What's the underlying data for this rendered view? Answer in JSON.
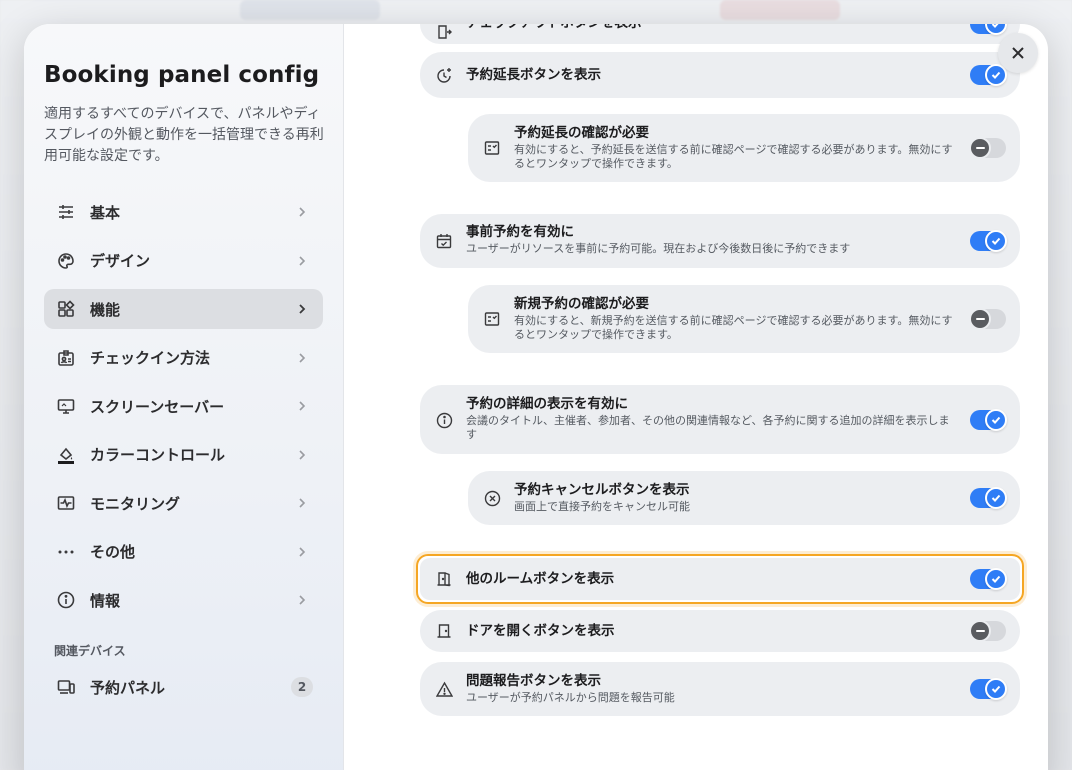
{
  "sidebar": {
    "title": "Booking panel config",
    "description": "適用するすべてのデバイスで、パネルやディスプレイの外観と動作を一括管理できる再利用可能な設定です。",
    "items": [
      {
        "label": "基本",
        "icon": "sliders-icon",
        "active": false
      },
      {
        "label": "デザイン",
        "icon": "palette-icon",
        "active": false
      },
      {
        "label": "機能",
        "icon": "widgets-icon",
        "active": true
      },
      {
        "label": "チェックイン方法",
        "icon": "badge-icon",
        "active": false
      },
      {
        "label": "スクリーンセーバー",
        "icon": "monitor-icon",
        "active": false
      },
      {
        "label": "カラーコントロール",
        "icon": "paint-bucket-icon",
        "active": false
      },
      {
        "label": "モニタリング",
        "icon": "pulse-icon",
        "active": false
      },
      {
        "label": "その他",
        "icon": "more-icon",
        "active": false
      },
      {
        "label": "情報",
        "icon": "info-icon",
        "active": false
      }
    ],
    "related_section": "関連デバイス",
    "related_device": {
      "label": "予約パネル",
      "count": "2",
      "icon": "devices-icon"
    }
  },
  "settings": [
    {
      "title": "チェックアウトボタンを表示",
      "subtitle": "",
      "enabled": true,
      "icon": "checkout-icon"
    },
    {
      "title": "予約延長ボタンを表示",
      "subtitle": "",
      "enabled": true,
      "icon": "clock-plus-icon"
    },
    {
      "title": "予約延長の確認が必要",
      "subtitle": "有効にすると、予約延長を送信する前に確認ページで確認する必要があります。無効にするとワンタップで操作できます。",
      "enabled": false,
      "icon": "checklist-icon"
    },
    {
      "title": "事前予約を有効に",
      "subtitle": "ユーザーがリソースを事前に予約可能。現在および今後数日後に予約できます",
      "enabled": true,
      "icon": "calendar-check-icon"
    },
    {
      "title": "新規予約の確認が必要",
      "subtitle": "有効にすると、新規予約を送信する前に確認ページで確認する必要があります。無効にするとワンタップで操作できます。",
      "enabled": false,
      "icon": "checklist-icon"
    },
    {
      "title": "予約の詳細の表示を有効に",
      "subtitle": "会議のタイトル、主催者、参加者、その他の関連情報など、各予約に関する追加の詳細を表示します",
      "enabled": true,
      "icon": "info-icon"
    },
    {
      "title": "予約キャンセルボタンを表示",
      "subtitle": "画面上で直接予約をキャンセル可能",
      "enabled": true,
      "icon": "cancel-circle-icon"
    },
    {
      "title": "他のルームボタンを表示",
      "subtitle": "",
      "enabled": true,
      "icon": "door-open-icon"
    },
    {
      "title": "ドアを開くボタンを表示",
      "subtitle": "",
      "enabled": false,
      "icon": "door-icon"
    },
    {
      "title": "問題報告ボタンを表示",
      "subtitle": "ユーザーが予約パネルから問題を報告可能",
      "enabled": true,
      "icon": "warning-icon"
    }
  ],
  "colors": {
    "accent": "#2f7df6",
    "focus": "#f5a623"
  }
}
